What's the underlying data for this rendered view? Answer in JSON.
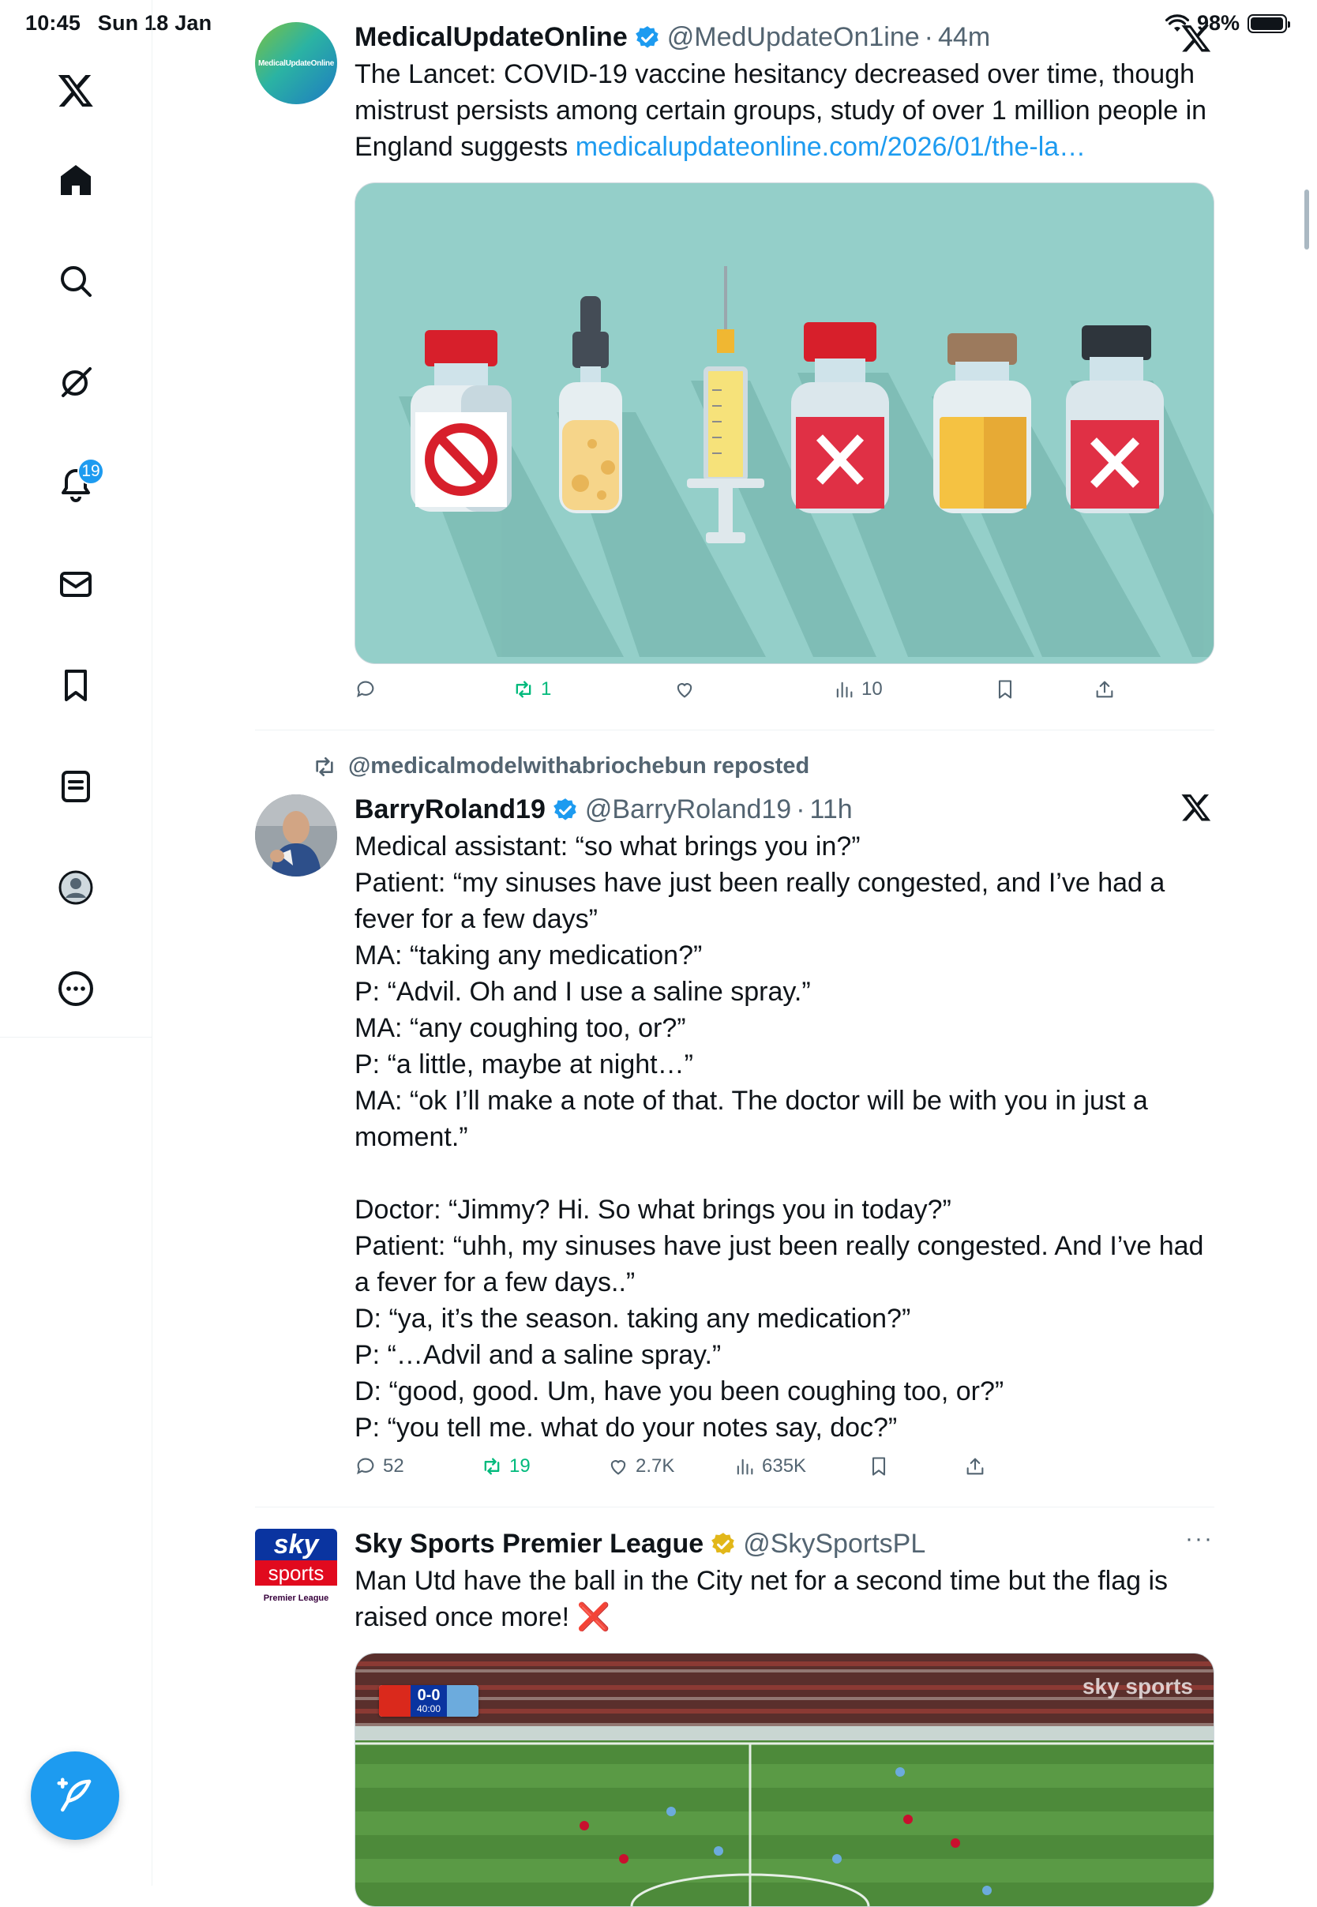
{
  "status_bar": {
    "time": "10:45",
    "date": "Sun 18 Jan",
    "battery": "98%",
    "battery_level": 0.98
  },
  "sidebar": {
    "items": [
      {
        "name": "x-logo-icon"
      },
      {
        "name": "home-icon",
        "label": "Home"
      },
      {
        "name": "search-icon",
        "label": "Explore"
      },
      {
        "name": "grok-icon",
        "label": "Grok"
      },
      {
        "name": "bell-icon",
        "label": "Notifications",
        "badge": "19"
      },
      {
        "name": "mail-icon",
        "label": "Messages"
      },
      {
        "name": "bookmark-icon",
        "label": "Bookmarks"
      },
      {
        "name": "list-icon",
        "label": "Lists"
      },
      {
        "name": "profile-icon",
        "label": "Profile"
      },
      {
        "name": "more-icon",
        "label": "More"
      }
    ],
    "notification_badge": "19"
  },
  "tweets": [
    {
      "name": "MedicalUpdateOnline",
      "handle": "@MedUpdateOn1ine",
      "time": "44m",
      "verified": "blue",
      "avatar_text": "MedicalUpdateOnline",
      "text": "The Lancet: COVID-19 vaccine hesitancy decreased over time, though mistrust persists among certain groups, study of over 1 million people in England suggests ",
      "link": "medicalupdateonline.com/2026/01/the-la…",
      "stats": {
        "replies": "",
        "retweets": "1",
        "likes": "",
        "views": "10"
      }
    },
    {
      "reposted_by": "@medicalmodelwithabriochebun reposted",
      "name": "BarryRoland19",
      "handle": "@BarryRoland19",
      "time": "11h",
      "verified": "blue",
      "text": "Medical assistant: “so what brings you in?”\nPatient: “my sinuses have just been really congested, and I’ve had a fever for a few days”\nMA: “taking any medication?”\nP: “Advil. Oh and I use a saline spray.”\nMA: “any coughing too, or?”\nP: “a little, maybe at night…”\nMA: “ok I’ll make a note of that. The doctor will be with you in just a moment.”\n\nDoctor: “Jimmy? Hi. So what brings you in today?”\nPatient: “uhh, my sinuses have just been really congested. And I’ve had a fever for a few days..”\nD: “ya, it’s the season. taking any medication?”\nP: “…Advil and a saline spray.”\nD: “good, good. Um, have you been coughing too, or?”\nP: “you tell me. what do your notes say, doc?”",
      "stats": {
        "replies": "52",
        "retweets": "19",
        "likes": "2.7K",
        "views": "635K"
      }
    },
    {
      "name": "Sky Sports Premier League",
      "handle": "@SkySportsPL",
      "verified": "gold",
      "avatar_top": "sky",
      "avatar_mid": "sports",
      "avatar_bottom": "Premier League",
      "text": "Man Utd have the ball in the City net for a second time but the flag is raised once more! ",
      "emoji": "❌",
      "score": "0-0",
      "clock": "40:00",
      "watermark": "sky sports",
      "more": "···"
    }
  ],
  "colors": {
    "accent": "#1d9bf0",
    "retweet": "#00ba7c",
    "muted": "#536471",
    "gold": "#e2b719",
    "sky_red": "#e10a1e",
    "sky_blue": "#0a34a0"
  }
}
